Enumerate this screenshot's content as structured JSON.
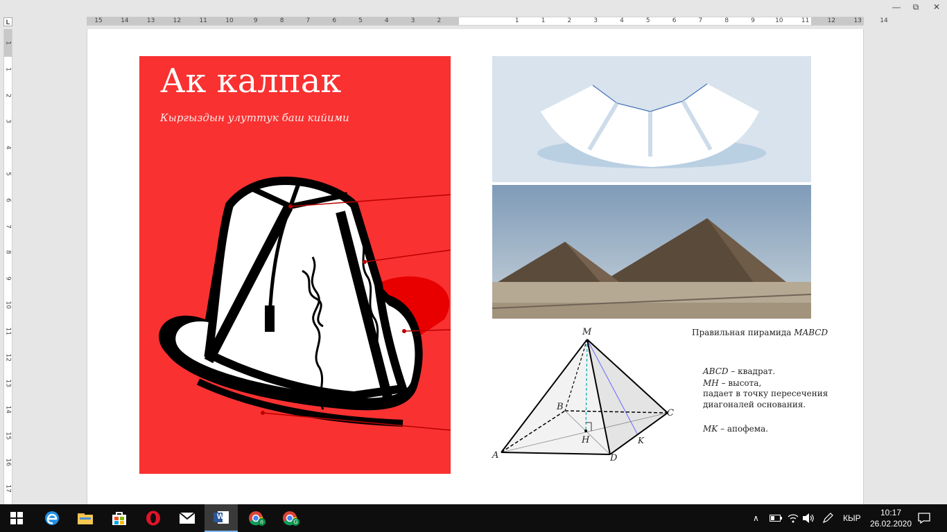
{
  "window": {
    "minimize_glyph": "—",
    "restore_glyph": "⧉",
    "close_glyph": "✕"
  },
  "ruler": {
    "corner_label": "L",
    "ticks": [
      "15",
      "14",
      "13",
      "12",
      "11",
      "10",
      "9",
      "8",
      "7",
      "6",
      "5",
      "4",
      "3",
      "2",
      "1",
      "1",
      "2",
      "3",
      "4",
      "5",
      "6",
      "7",
      "8",
      "9",
      "10",
      "11",
      "12",
      "13",
      "14"
    ],
    "vticks": [
      "1",
      "1",
      "2",
      "3",
      "4",
      "5",
      "6",
      "7",
      "8",
      "9",
      "10",
      "11",
      "12",
      "13",
      "14",
      "15",
      "16",
      "17"
    ]
  },
  "poster": {
    "title": "Ак калпак",
    "subtitle": "Кыргыздын улуттук баш кийими"
  },
  "diagram": {
    "caption_title": "Правильная пирамида",
    "caption_title_name": "MABCD",
    "labels": {
      "M": "M",
      "A": "A",
      "B": "B",
      "C": "C",
      "D": "D",
      "H": "H",
      "K": "K"
    },
    "line1_var": "ABCD",
    "line1_text": " – квадрат.",
    "line2_var": "MH",
    "line2_text": " – высота,",
    "line3_text": "падает в точку пересечения",
    "line4_text": "диагоналей основания.",
    "line5_var": "MK",
    "line5_text": " – апофема."
  },
  "taskbar": {
    "apps": [
      {
        "name": "start-button",
        "icon": "windows-icon"
      },
      {
        "name": "edge-button",
        "icon": "edge-icon"
      },
      {
        "name": "explorer-button",
        "icon": "folder-icon"
      },
      {
        "name": "store-button",
        "icon": "store-icon"
      },
      {
        "name": "opera-button",
        "icon": "opera-icon"
      },
      {
        "name": "mail-button",
        "icon": "mail-icon"
      },
      {
        "name": "word-button",
        "icon": "word-icon"
      },
      {
        "name": "chrome-p-button",
        "icon": "chrome-icon"
      },
      {
        "name": "chrome-g-button",
        "icon": "chrome-icon"
      }
    ],
    "word_letter": "W",
    "chrome_p_badge": "п",
    "chrome_g_badge": "G",
    "language": "КЫР",
    "time": "10:17",
    "date": "26.02.2020"
  },
  "colors": {
    "poster_red": "#f93131",
    "taskbar": "#0e0e0e",
    "accent": "#7db9ff"
  }
}
